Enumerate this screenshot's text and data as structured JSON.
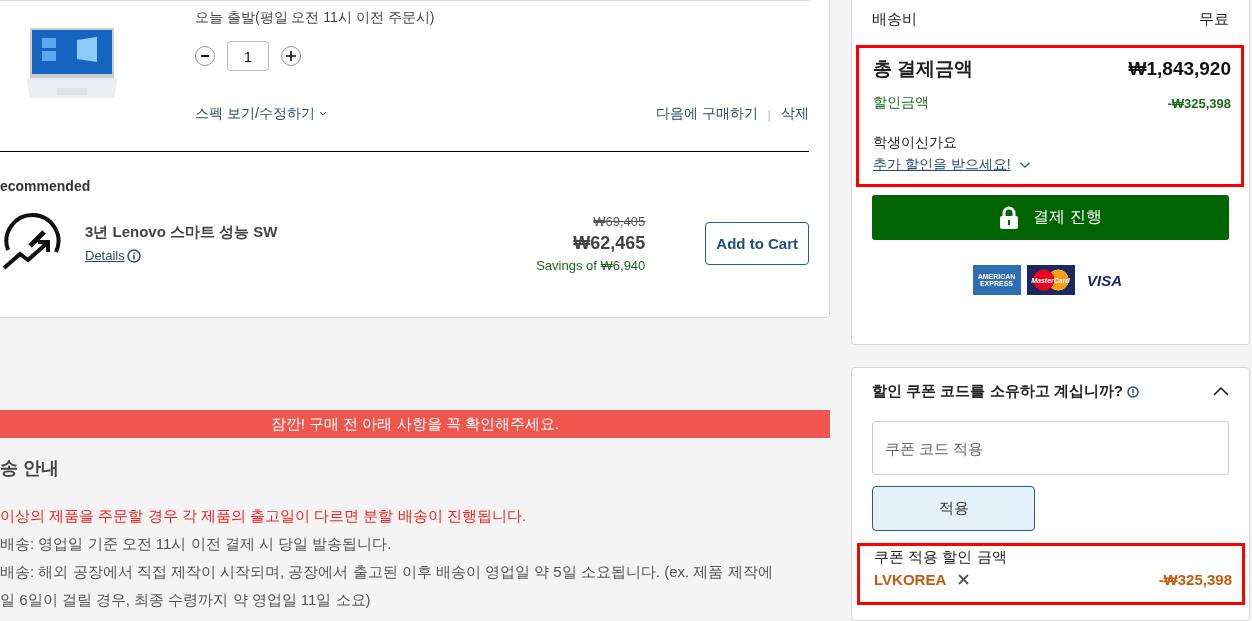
{
  "cart_item": {
    "delivery": "오늘 출발(평일 오전 11시 이전 주문시)",
    "quantity": "1",
    "spec_link": "스펙 보기/수정하기",
    "save_later": "다음에 구매하기",
    "separator": "|",
    "delete": "삭제"
  },
  "recommended": {
    "title": "ecommended",
    "items": [
      {
        "name": "3년 Lenovo 스마트 성능 SW",
        "details": "Details",
        "original_price": "₩69,405",
        "price": "₩62,465",
        "savings": "Savings of ₩6,940",
        "button": "Add to Cart"
      }
    ]
  },
  "notice": {
    "banner": "잠깐! 구매 전 아래 사항을 꼭 확인해주세요.",
    "heading": "송 안내",
    "lines": [
      {
        "kind": "warning",
        "text": "이상의 제품을 주문할 경우 각 제품의 출고일이 다르면 분할 배송이 진행됩니다."
      },
      {
        "kind": "normal",
        "text": "배송: 영업일 기준 오전 11시 이전 결제 시 당일 발송됩니다."
      },
      {
        "kind": "normal",
        "text": "배송: 해외 공장에서 직접 제작이 시작되며, 공장에서 출고된 이후 배송이 영업일 약 5일 소요됩니다. (ex. 제품 제작에"
      },
      {
        "kind": "normal",
        "text": "일 6일이 걸릴 경우, 최종 수령까지 약 영업일 11일 소요)"
      }
    ]
  },
  "summary": {
    "shipping_label": "배송비",
    "shipping_value": "무료",
    "total_label": "총 결제금액",
    "total_value": "₩1,843,920",
    "discount_label": "할인금액",
    "discount_value": "-₩325,398",
    "student_question": "학생이신가요",
    "student_link": "추가 할인을 받으세요!",
    "checkout_button": "결제 진행",
    "payment_methods": [
      {
        "kind": "amex",
        "label": "AMERICAN EXPRESS"
      },
      {
        "kind": "mastercard",
        "label": "MasterCard"
      },
      {
        "kind": "visa",
        "label": "VISA"
      }
    ]
  },
  "coupon": {
    "title": "할인 쿠폰 코드를 소유하고 계십니까?",
    "expanded": true,
    "placeholder": "쿠폰 코드 적용",
    "apply_button": "적용",
    "applied_label": "쿠폰 적용 할인 금액",
    "code": "LVKOREA",
    "amount": "-₩325,398"
  }
}
